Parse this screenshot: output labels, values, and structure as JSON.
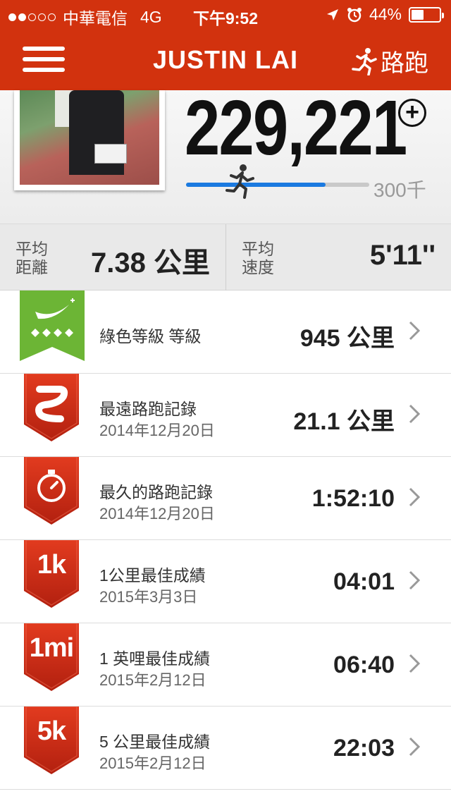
{
  "status_bar": {
    "carrier": "中華電信",
    "network": "4G",
    "time": "下午9:52",
    "battery": "44%",
    "battery_level": 0.44
  },
  "nav": {
    "title": "JUSTIN LAI",
    "run_label": "路跑"
  },
  "profile": {
    "total": "229,221",
    "goal": "300千",
    "progress": 0.76
  },
  "averages": {
    "distance_label": "平均距離",
    "distance_value": "7.38 公里",
    "pace_label": "平均速度",
    "pace_value": "5'11''"
  },
  "records": [
    {
      "title": "綠色等級 等級",
      "date": "",
      "value": "945 公里",
      "icon": "green-level-badge"
    },
    {
      "title": "最遠路跑記錄",
      "date": "2014年12月20日",
      "value": "21.1 公里",
      "icon": "winding-road-icon",
      "badge_text": ""
    },
    {
      "title": "最久的路跑記錄",
      "date": "2014年12月20日",
      "value": "1:52:10",
      "icon": "stopwatch-icon",
      "badge_text": ""
    },
    {
      "title": "1公里最佳成績",
      "date": "2015年3月3日",
      "value": "04:01",
      "icon": "text-badge",
      "badge_text": "1k"
    },
    {
      "title": "1 英哩最佳成績",
      "date": "2015年2月12日",
      "value": "06:40",
      "icon": "text-badge",
      "badge_text": "1mi"
    },
    {
      "title": "5 公里最佳成績",
      "date": "2015年2月12日",
      "value": "22:03",
      "icon": "text-badge",
      "badge_text": "5k"
    }
  ],
  "colors": {
    "brand": "#d2320e",
    "badge_red": "#c92a17",
    "badge_green": "#6cb535",
    "progress": "#1b7ae0"
  }
}
